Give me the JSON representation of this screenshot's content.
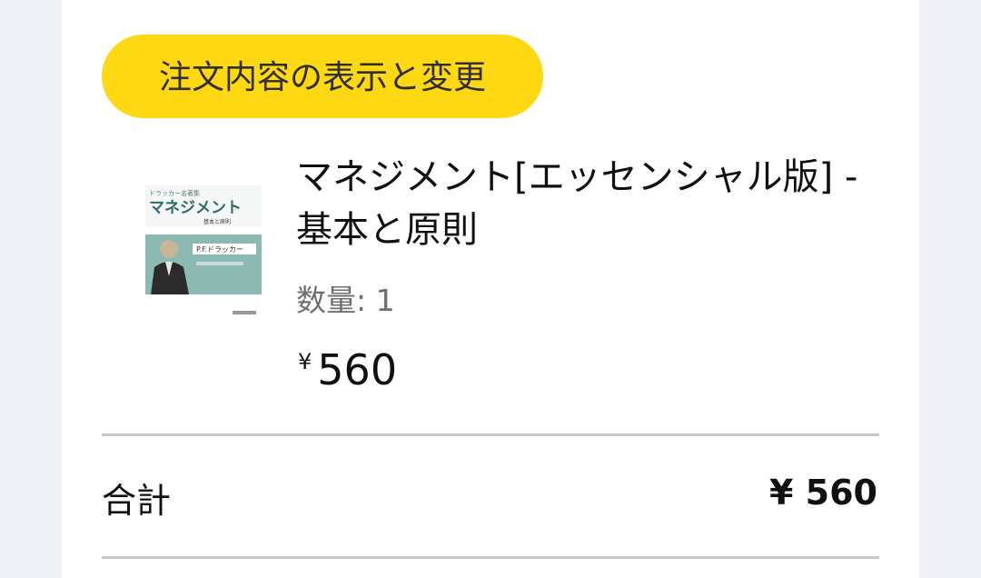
{
  "order": {
    "edit_button_label": "注文内容の表示と変更"
  },
  "item": {
    "cover": {
      "series": "ドラッカー名著集",
      "title": "マネジメント",
      "subtitle": "基本と原則",
      "author": "P.F.ドラッカー"
    },
    "title": "マネジメント[エッセンシャル版] - 基本と原則",
    "quantity_label": "数量: 1",
    "price_symbol": "¥",
    "price_value": "560"
  },
  "summary": {
    "total_label": "合計",
    "total_value": "¥ 560"
  },
  "colors": {
    "accent_button": "#ffd814",
    "page_background": "#eef0f6",
    "divider": "#c8c8c8"
  }
}
